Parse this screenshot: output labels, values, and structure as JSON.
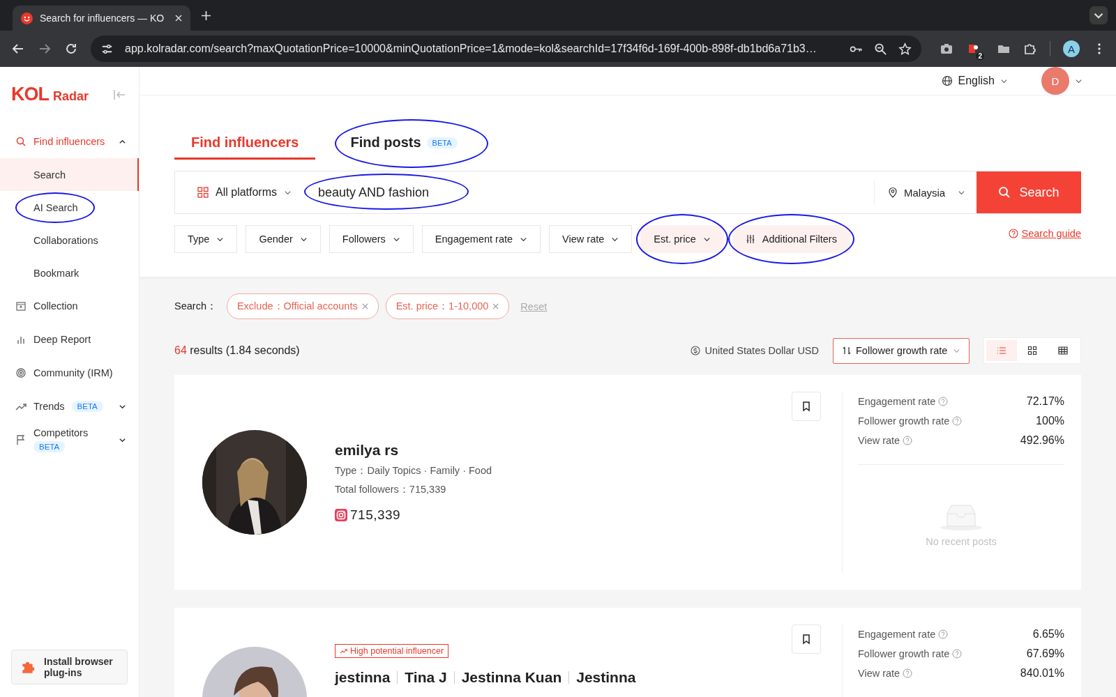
{
  "browser": {
    "tab_title": "Search for influencers — KO",
    "url": "app.kolradar.com/search?maxQuotationPrice=10000&minQuotationPrice=1&mode=kol&searchId=17f34f6d-169f-400b-898f-db1bd6a71b3…",
    "extension_badge": "2",
    "profile_initial": "A"
  },
  "sidebar": {
    "logo": {
      "mark": "KOL",
      "word": "Radar"
    },
    "items": [
      {
        "label": "Find influencers",
        "selected": true,
        "expanded": true,
        "children": [
          {
            "label": "Search",
            "selected": true,
            "circled": false
          },
          {
            "label": "AI Search",
            "selected": false,
            "circled": true
          },
          {
            "label": "Collaborations",
            "selected": false,
            "circled": false
          },
          {
            "label": "Bookmark",
            "selected": false,
            "circled": false
          }
        ]
      },
      {
        "label": "Collection",
        "selected": false
      },
      {
        "label": "Deep Report",
        "selected": false
      },
      {
        "label": "Community (IRM)",
        "selected": false
      },
      {
        "label": "Trends",
        "selected": false,
        "badge": "BETA",
        "expanded": false
      },
      {
        "label": "Competitors",
        "selected": false,
        "badge": "BETA",
        "expanded": false
      }
    ],
    "install": "Install browser plug-ins"
  },
  "header": {
    "language": "English",
    "avatar": "D"
  },
  "tabs": [
    {
      "label": "Find influencers",
      "selected": true,
      "circled": false
    },
    {
      "label": "Find posts",
      "badge": "BETA",
      "selected": false,
      "circled": true
    }
  ],
  "search": {
    "platform": "All platforms",
    "value": "beauty AND fashion",
    "circled": true,
    "location": "Malaysia",
    "button": "Search"
  },
  "filters": [
    {
      "label": "Type",
      "active": false,
      "circled": false,
      "kind": "dropdown"
    },
    {
      "label": "Gender",
      "active": false,
      "circled": false,
      "kind": "dropdown"
    },
    {
      "label": "Followers",
      "active": false,
      "circled": false,
      "kind": "dropdown"
    },
    {
      "label": "Engagement rate",
      "active": false,
      "circled": false,
      "kind": "dropdown"
    },
    {
      "label": "View rate",
      "active": false,
      "circled": false,
      "kind": "dropdown"
    },
    {
      "label": "Est. price",
      "active": true,
      "circled": true,
      "kind": "dropdown"
    },
    {
      "label": "Additional Filters",
      "active": true,
      "circled": true,
      "kind": "more"
    }
  ],
  "search_guide": "Search guide",
  "applied": {
    "label": "Search：",
    "chips": [
      "Exclude：Official accounts",
      "Est. price：1-10,000"
    ],
    "reset": "Reset"
  },
  "results": {
    "count": "64",
    "summary": "results (1.84 seconds)",
    "currency": "United States Dollar USD",
    "sort": "Follower growth rate",
    "views": [
      {
        "kind": "list",
        "selected": true
      },
      {
        "kind": "grid",
        "selected": false
      },
      {
        "kind": "table",
        "selected": false
      }
    ]
  },
  "cards": [
    {
      "names": [
        "emilya rs"
      ],
      "type_line": "Type：Daily Topics · Family · Food",
      "followers_line": "Total followers：715,339",
      "platform_followers": "715,339",
      "metrics": [
        {
          "label": "Engagement rate",
          "value": "72.17%"
        },
        {
          "label": "Follower growth rate",
          "value": "100%"
        },
        {
          "label": "View rate",
          "value": "492.96%"
        }
      ],
      "posts_empty": "No recent posts"
    },
    {
      "tag": "High potential influencer",
      "names": [
        "jestinna",
        "Tina J",
        "Jestinna Kuan",
        "Jestinna"
      ],
      "metrics": [
        {
          "label": "Engagement rate",
          "value": "6.65%"
        },
        {
          "label": "Follower growth rate",
          "value": "67.69%"
        },
        {
          "label": "View rate",
          "value": "840.01%"
        }
      ]
    }
  ]
}
